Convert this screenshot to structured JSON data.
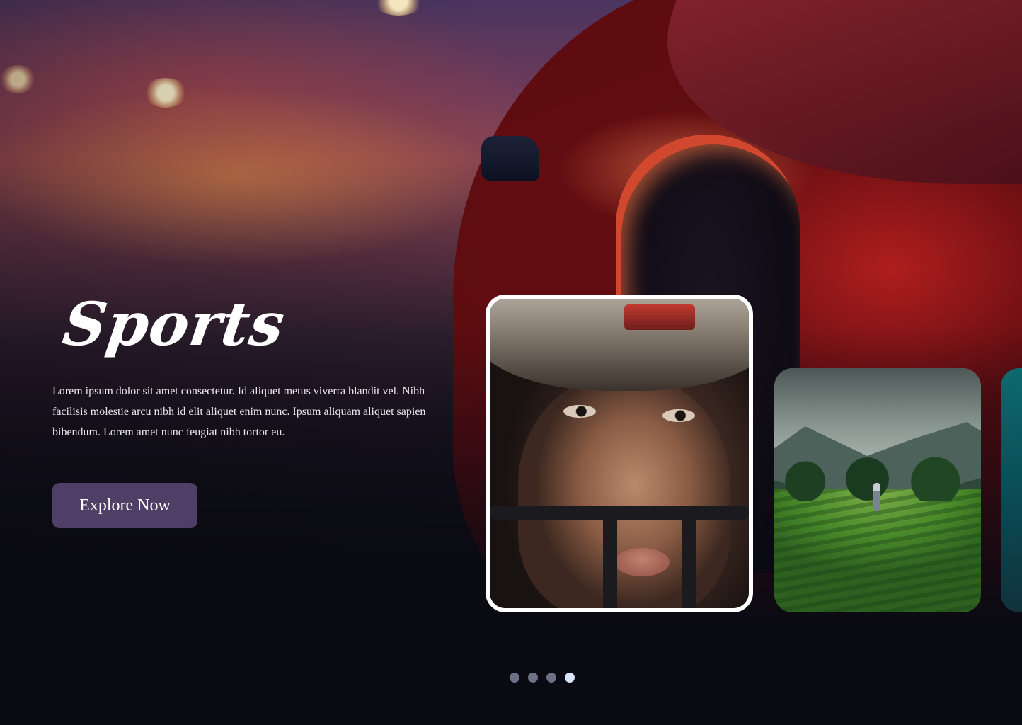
{
  "hero": {
    "title": "Sports",
    "description": "Lorem ipsum dolor sit amet consectetur. Id aliquet metus viverra blandit vel. Nibh facilisis molestie arcu nibh id elit aliquet enim nunc. Ipsum aliquam aliquet sapien bibendum. Lorem amet nunc feugiat nibh tortor eu.",
    "cta_label": "Explore Now",
    "background": "red-sports-car-at-dusk"
  },
  "carousel": {
    "active_index": 3,
    "total": 4,
    "cards": [
      {
        "subject": "football-player-with-helmet",
        "active": true
      },
      {
        "subject": "green-hills-with-person",
        "active": false
      },
      {
        "subject": "teal-partial-card",
        "active": false
      }
    ]
  },
  "colors": {
    "accent_button": "#4f3e66",
    "active_dot": "#dbe4ff",
    "inactive_dot": "#6c7186",
    "background": "#0a0a12"
  }
}
